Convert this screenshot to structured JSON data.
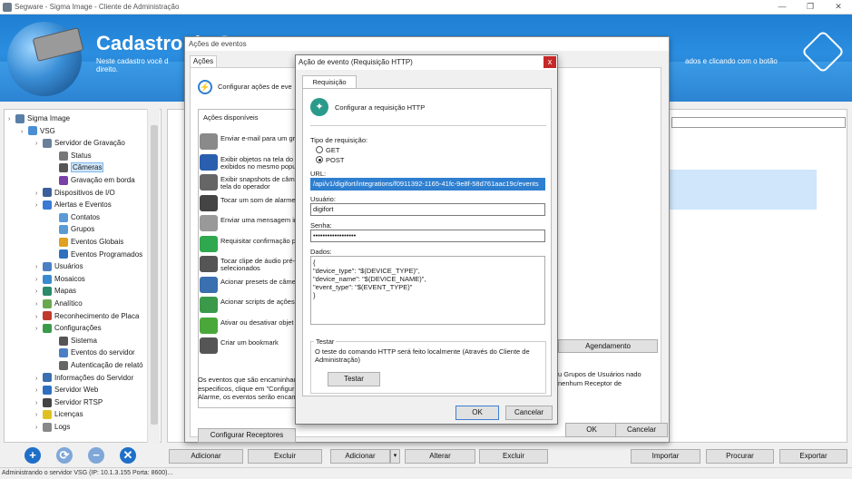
{
  "window": {
    "title": "Segware - Sigma Image - Cliente de Administração",
    "controls": [
      "—",
      "❐",
      "✕"
    ]
  },
  "banner": {
    "heading": "Cadastro de C",
    "desc_left": "Neste cadastro você d",
    "desc_left_2": "direito.",
    "desc_right": "ados e clicando com o botão"
  },
  "tree": {
    "items": [
      {
        "label": "Sigma Image",
        "level": 0,
        "color": "#5a7fa8"
      },
      {
        "label": "VSG",
        "level": 1,
        "color": "#4a8fd4"
      },
      {
        "label": "Servidor de Gravação",
        "level": 2,
        "color": "#6a7f99"
      },
      {
        "label": "Status",
        "level": 3,
        "color": "#777777"
      },
      {
        "label": "Câmeras",
        "level": 3,
        "color": "#555555",
        "selected": true
      },
      {
        "label": "Gravação em borda",
        "level": 3,
        "color": "#7b3fa8"
      },
      {
        "label": "Dispositivos de I/O",
        "level": 2,
        "color": "#3a5f9a"
      },
      {
        "label": "Alertas e Eventos",
        "level": 2,
        "color": "#3a7ad4"
      },
      {
        "label": "Contatos",
        "level": 3,
        "color": "#5c9ad6"
      },
      {
        "label": "Grupos",
        "level": 3,
        "color": "#5c9ad6"
      },
      {
        "label": "Eventos Globais",
        "level": 3,
        "color": "#e0a020"
      },
      {
        "label": "Eventos Programados",
        "level": 3,
        "color": "#2f6fbf"
      },
      {
        "label": "Usuários",
        "level": 2,
        "color": "#4a7fc4"
      },
      {
        "label": "Mosaicos",
        "level": 2,
        "color": "#3a8ad0"
      },
      {
        "label": "Mapas",
        "level": 2,
        "color": "#2a8a6a"
      },
      {
        "label": "Analítico",
        "level": 2,
        "color": "#6aa84f"
      },
      {
        "label": "Reconhecimento de Placa",
        "level": 2,
        "color": "#c0392b"
      },
      {
        "label": "Configurações",
        "level": 2,
        "color": "#3a9a4a"
      },
      {
        "label": "Sistema",
        "level": 3,
        "color": "#555555"
      },
      {
        "label": "Eventos do servidor",
        "level": 3,
        "color": "#4a7fc4"
      },
      {
        "label": "Autenticação de relató",
        "level": 3,
        "color": "#666666"
      },
      {
        "label": "Informações do Servidor",
        "level": 2,
        "color": "#3a6fb0"
      },
      {
        "label": "Servidor Web",
        "level": 2,
        "color": "#2f6fbf"
      },
      {
        "label": "Servidor RTSP",
        "level": 2,
        "color": "#444444"
      },
      {
        "label": "Licenças",
        "level": 2,
        "color": "#e0c020"
      },
      {
        "label": "Logs",
        "level": 2,
        "color": "#888888"
      }
    ]
  },
  "bottom_icons": [
    {
      "name": "add-circle-icon",
      "glyph": "+",
      "color": "#1f6fc8"
    },
    {
      "name": "refresh-circle-icon",
      "glyph": "⟳",
      "color": "#7fa7d8"
    },
    {
      "name": "remove-circle-icon",
      "glyph": "−",
      "color": "#7fa7d8"
    },
    {
      "name": "delete-circle-icon",
      "glyph": "✕",
      "color": "#1f6fc8"
    }
  ],
  "main_buttons": {
    "adicionar_left": "Adicionar",
    "excluir_left": "Excluir",
    "adicionar_mid": "Adicionar",
    "alterar": "Alterar",
    "excluir_mid": "Excluir",
    "importar": "Importar",
    "procurar": "Procurar",
    "exportar": "Exportar"
  },
  "statusbar": "Administrando o servidor VSG (IP: 10.1.3.155 Porta: 8600)...",
  "acoes_dialog": {
    "title": "Ações de eventos",
    "tab": "Ações",
    "configurar_label": "Configurar ações de eve",
    "disponiveis_label": "Ações disponíveis",
    "items": [
      {
        "label": "Enviar e-mail para um gru",
        "color": "#8a8a8a"
      },
      {
        "label": "Exibir objetos na tela do exibidos no mesmo popup",
        "color": "#2a5fb0"
      },
      {
        "label": "Exibir snapshots de câme tela do operador",
        "color": "#666666"
      },
      {
        "label": "Tocar um som de alarme",
        "color": "#444444"
      },
      {
        "label": "Enviar uma mensagem in",
        "color": "#999999"
      },
      {
        "label": "Requisitar confirmação p",
        "color": "#2fa84f"
      },
      {
        "label": "Tocar clipe de áudio pré- selecionados",
        "color": "#555555"
      },
      {
        "label": "Acionar presets de câmer",
        "color": "#3a6fb0"
      },
      {
        "label": "Acionar scripts de ações",
        "color": "#3a9a4a"
      },
      {
        "label": "Ativar ou desativar objet",
        "color": "#4aa83a"
      },
      {
        "label": "Criar um bookmark",
        "color": "#555555"
      }
    ],
    "footer_text": "Os eventos que são encaminhado especificos, clique em \"Configur Alarme, os eventos serão encami",
    "configurar_receptores": "Configurar Receptores",
    "right_text": "u Grupos de Usuários nado nenhum Receptor de",
    "agendamento": "Agendamento",
    "ok": "OK",
    "cancelar": "Cancelar"
  },
  "http_dialog": {
    "title": "Ação de evento (Requisição HTTP)",
    "close": "x",
    "tab": "Requisição HTTP",
    "header": "Configurar a requisição HTTP",
    "tipo_label": "Tipo de requisição:",
    "option_get": "GET",
    "option_post": "POST",
    "selected_method": "POST",
    "url_label": "URL:",
    "url_value": "/api/v1/digifort/integrations/f0911392-1165-41fc-9e8f-58d761aac19c/events",
    "usuario_label": "Usuário:",
    "usuario_value": "digifort",
    "senha_label": "Senha:",
    "senha_value": "••••••••••••••••••",
    "dados_label": "Dados:",
    "dados_value": "{\n\"device_type\": \"$(DEVICE_TYPE)\",\n\"device_name\": \"$(DEVICE_NAME)\",\n\"event_type\": \"$(EVENT_TYPE)\"\n}",
    "testar_group": "Testar",
    "testar_desc": "O teste do comando HTTP será feito localmente (Através do Cliente de Administração)",
    "testar_button": "Testar",
    "ok": "OK",
    "cancelar": "Cancelar"
  }
}
